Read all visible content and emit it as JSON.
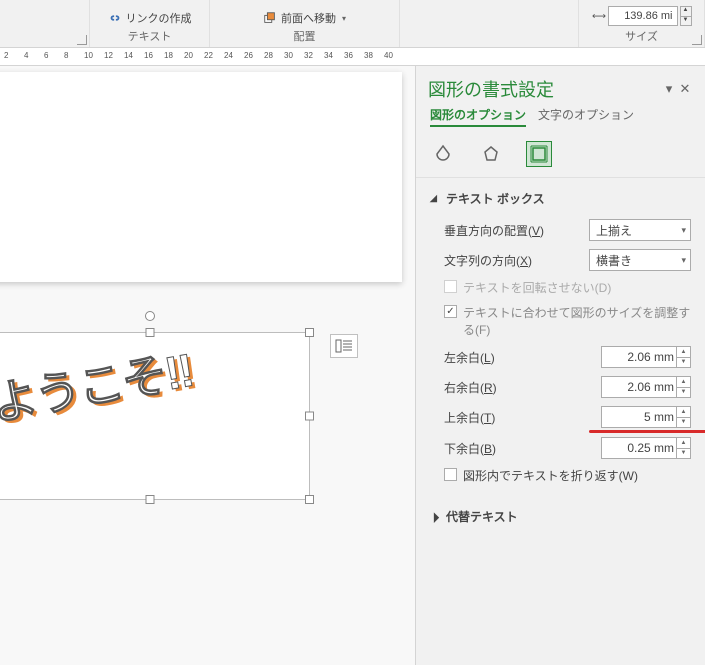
{
  "ribbon": {
    "link_create": "リンクの作成",
    "prev_move": "前面へ移動",
    "group_text": "テキスト",
    "group_arrange": "配置",
    "group_size": "サイズ",
    "size_value": "139.86 mi"
  },
  "ruler": {
    "ticks": [
      "2",
      "4",
      "6",
      "8",
      "10",
      "12",
      "14",
      "16",
      "18",
      "20",
      "22",
      "24",
      "26",
      "28",
      "30",
      "32",
      "34",
      "36",
      "38",
      "40"
    ]
  },
  "wordart_text": "ようこそ!!",
  "pane": {
    "title": "図形の書式設定",
    "tab_shape": "図形のオプション",
    "tab_text": "文字のオプション"
  },
  "textbox_section": {
    "title": "テキスト ボックス",
    "valign_label": "垂直方向の配置(",
    "valign_accel": "V",
    "valign_label_after": ")",
    "valign_value": "上揃え",
    "direction_label": "文字列の方向(",
    "direction_accel": "X",
    "direction_label_after": ")",
    "direction_value": "横書き",
    "no_rotate": "テキストを回転させない(",
    "no_rotate_accel": "D",
    "no_rotate_after": ")",
    "autofit": "テキストに合わせて図形のサイズを調整する(",
    "autofit_accel": "F",
    "autofit_after": ")",
    "left_margin_label": "左余白(",
    "left_margin_accel": "L",
    "left_margin_after": ")",
    "left_margin_value": "2.06 mm",
    "right_margin_label": "右余白(",
    "right_margin_accel": "R",
    "right_margin_after": ")",
    "right_margin_value": "2.06 mm",
    "top_margin_label": "上余白(",
    "top_margin_accel": "T",
    "top_margin_after": ")",
    "top_margin_value": "5 mm",
    "bottom_margin_label": "下余白(",
    "bottom_margin_accel": "B",
    "bottom_margin_after": ")",
    "bottom_margin_value": "0.25 mm",
    "wrap_text": "図形内でテキストを折り返す(",
    "wrap_text_accel": "W",
    "wrap_text_after": ")"
  },
  "alt_text_section": {
    "title": "代替テキスト"
  }
}
